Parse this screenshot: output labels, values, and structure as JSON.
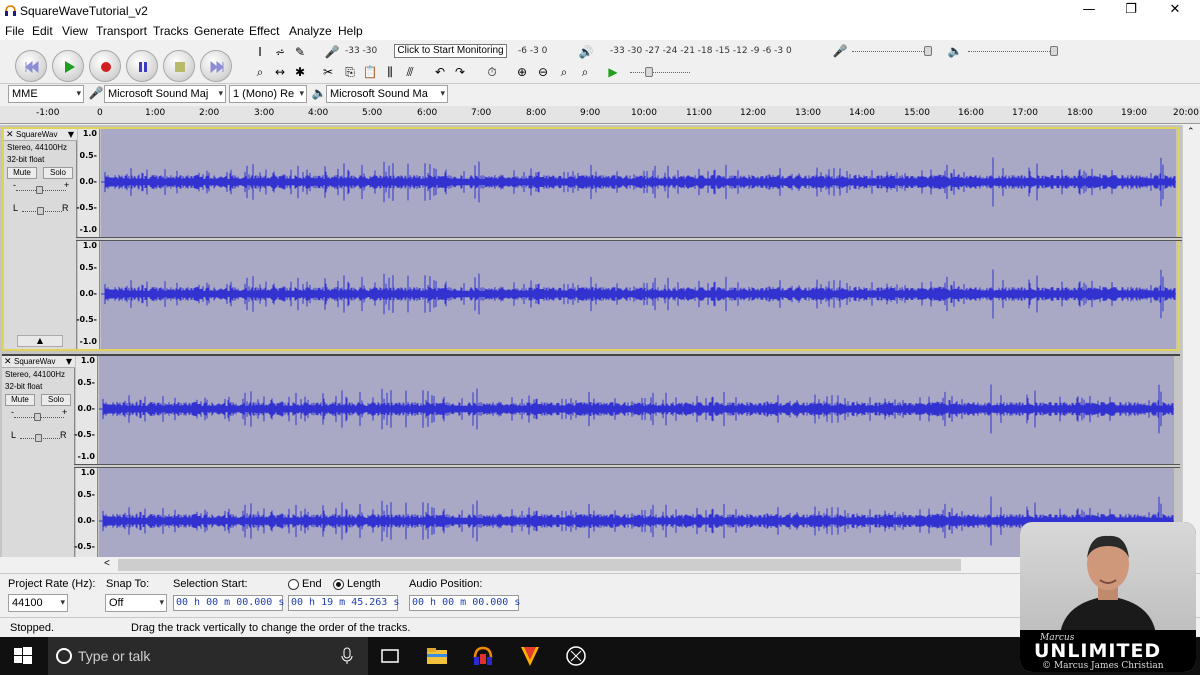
{
  "window": {
    "title": "SquareWaveTutorial_v2",
    "controls": {
      "minimize": "—",
      "restore": "❐",
      "close": "✕"
    }
  },
  "menu": [
    "File",
    "Edit",
    "View",
    "Transport",
    "Tracks",
    "Generate",
    "Effect",
    "Analyze",
    "Help"
  ],
  "transport_icons": [
    "skip-start-icon",
    "play-icon",
    "record-icon",
    "pause-icon",
    "stop-icon",
    "skip-end-icon"
  ],
  "meters": {
    "record_scale": "-33 -30",
    "record_scale_right": "-6 -3 0",
    "monitor_button": "Click to Start Monitoring",
    "play_scale": "-33 -30 -27 -24 -21 -18 -15 -12 -9 -6 -3 0",
    "lr_label": "L\nR"
  },
  "device": {
    "host": "MME",
    "recording_device": "Microsoft Sound Maj",
    "channels": "1 (Mono) Re",
    "playback_device": "Microsoft Sound Ma"
  },
  "ruler_ticks": [
    "-1:00",
    "0",
    "1:00",
    "2:00",
    "3:00",
    "4:00",
    "5:00",
    "6:00",
    "7:00",
    "8:00",
    "9:00",
    "10:00",
    "11:00",
    "12:00",
    "13:00",
    "14:00",
    "15:00",
    "16:00",
    "17:00",
    "18:00",
    "19:00",
    "20:00"
  ],
  "amplitude_labels": [
    "1.0",
    "0.5-",
    "0.0-",
    "-0.5-",
    "-1.0"
  ],
  "tracks": [
    {
      "name": "SquareWav",
      "format": "Stereo, 44100Hz",
      "depth": "32-bit float",
      "mute": "Mute",
      "solo": "Solo",
      "gain_minus": "-",
      "gain_plus": "+",
      "pan_left": "L",
      "pan_right": "R",
      "selected": true
    },
    {
      "name": "SquareWav",
      "format": "Stereo, 44100Hz",
      "depth": "32-bit float",
      "mute": "Mute",
      "solo": "Solo",
      "gain_minus": "-",
      "gain_plus": "+",
      "pan_left": "L",
      "pan_right": "R",
      "selected": false
    }
  ],
  "selection_toolbar": {
    "project_rate_label": "Project Rate (Hz):",
    "project_rate": "44100",
    "snap_label": "Snap To:",
    "snap_value": "Off",
    "selection_start_label": "Selection Start:",
    "end_label": "End",
    "length_label": "Length",
    "selection_start": "00 h 00 m 00.000 s",
    "length": "00 h 19 m 45.263 s",
    "audio_position_label": "Audio Position:",
    "audio_position": "00 h 00 m 00.000 s"
  },
  "status": {
    "state": "Stopped.",
    "hint": "Drag the track vertically to change the order of the tracks."
  },
  "taskbar": {
    "search_placeholder": "Type or talk"
  },
  "overlay": {
    "brand_small": "Marcus",
    "brand_big": "UNLIMITED",
    "copyright": "© Marcus James Christian"
  },
  "colors": {
    "waveform": "#3232d0",
    "waveform_bg": "#a9a9c6",
    "selection_border": "#e0d25a"
  }
}
